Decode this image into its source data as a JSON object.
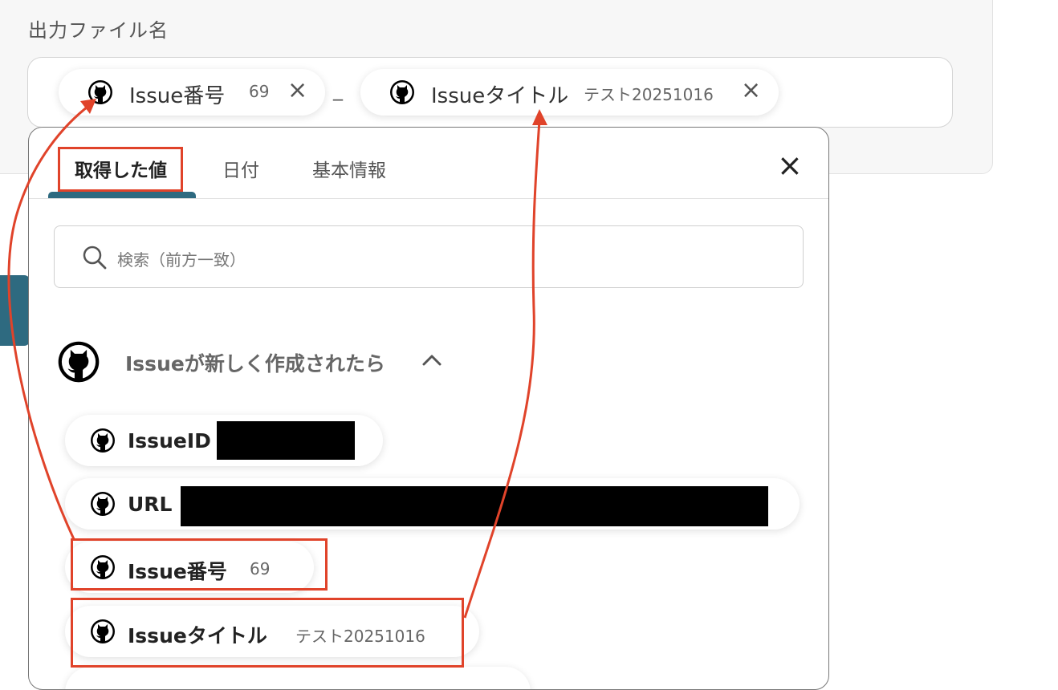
{
  "field": {
    "label": "出力ファイル名",
    "separator": "_",
    "chips": [
      {
        "label": "Issue番号",
        "value": "69",
        "icon": "github-icon"
      },
      {
        "label": "Issueタイトル",
        "value": "テスト20251016",
        "icon": "github-icon"
      }
    ],
    "remove_icon": "×"
  },
  "panel": {
    "tabs": [
      {
        "label": "取得した値"
      },
      {
        "label": "日付"
      },
      {
        "label": "基本情報"
      }
    ],
    "close_icon": "×",
    "search": {
      "placeholder": "検索（前方一致）"
    },
    "group": {
      "title": "Issueが新しく作成されたら",
      "items": [
        {
          "label": "IssueID",
          "value": ""
        },
        {
          "label": "URL",
          "value": ""
        },
        {
          "label": "Issue番号",
          "value": "69"
        },
        {
          "label": "Issueタイトル",
          "value": "テスト20251016"
        }
      ]
    }
  },
  "colors": {
    "accent": "#2e6a80",
    "highlight": "#e0432a"
  }
}
